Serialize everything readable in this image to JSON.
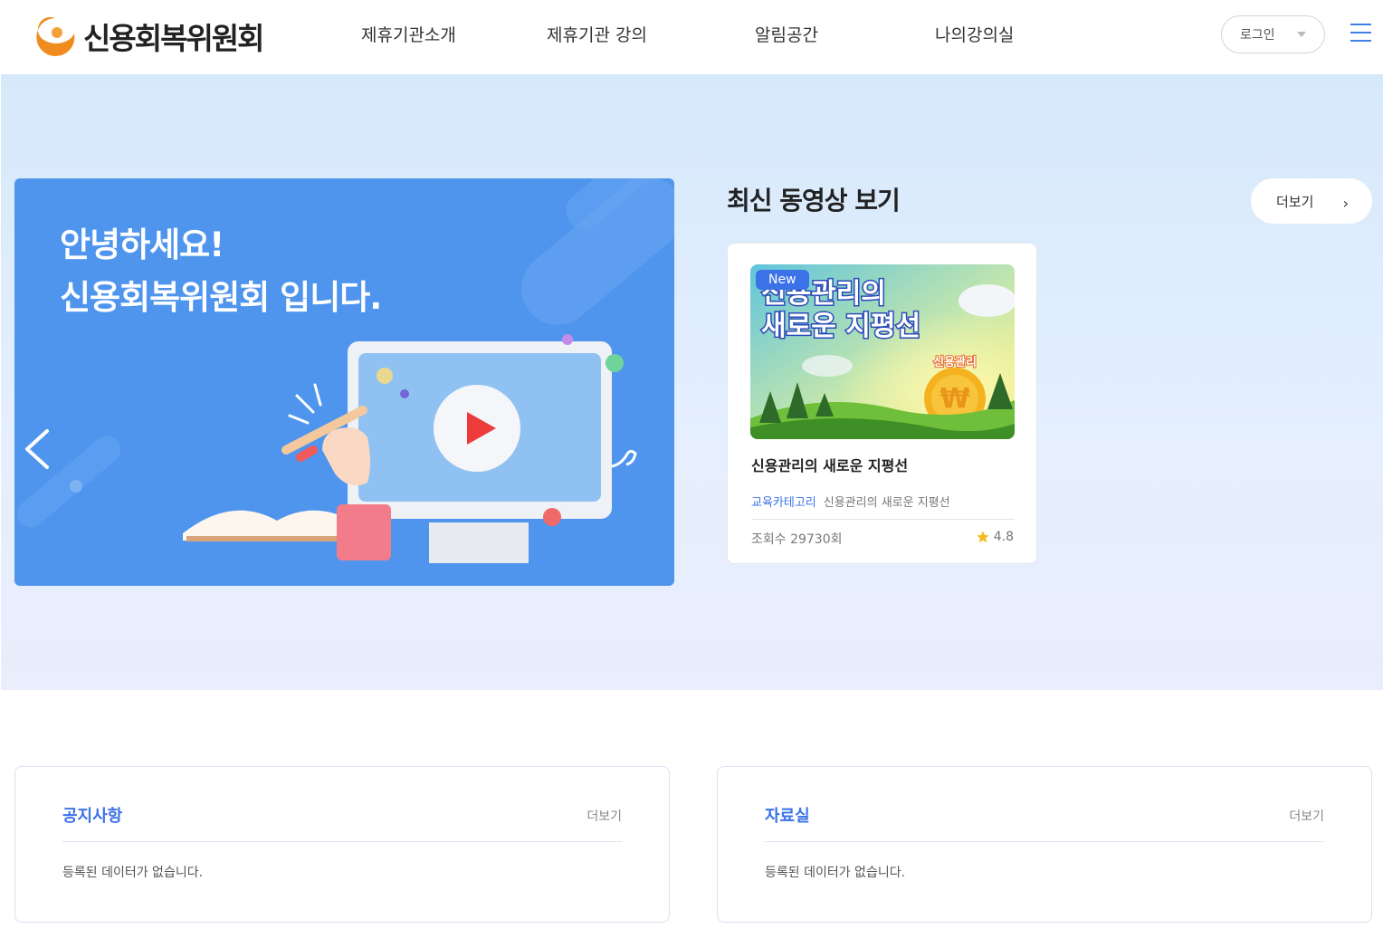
{
  "header": {
    "logo_text": "신용회복위원회",
    "nav": [
      "제휴기관소개",
      "제휴기관 강의",
      "알림공간",
      "나의강의실"
    ],
    "login_label": "로그인",
    "accent": "#3f7fe8",
    "logo_color": "#f08c1e"
  },
  "hero": {
    "banner_line1": "안녕하세요!",
    "banner_line2": "신용회복위원회 입니다.",
    "banner_color": "#4f95ee"
  },
  "videos": {
    "section_title": "최신 동영상 보기",
    "more_label": "더보기",
    "card": {
      "badge": "New",
      "thumb_title_line1": "신용관리의",
      "thumb_title_line2": "새로운 지평선",
      "thumb_tag": "신용관리",
      "title": "신용관리의 새로운 지평선",
      "category": "교육카테고리",
      "category_sub": "신용관리의 새로운 지평선",
      "views": "조회수 29730회",
      "rating": "4.8"
    }
  },
  "boards": [
    {
      "title": "공지사항",
      "more": "더보기",
      "empty": "등록된 데이터가 없습니다."
    },
    {
      "title": "자료실",
      "more": "더보기",
      "empty": "등록된 데이터가 없습니다."
    }
  ]
}
